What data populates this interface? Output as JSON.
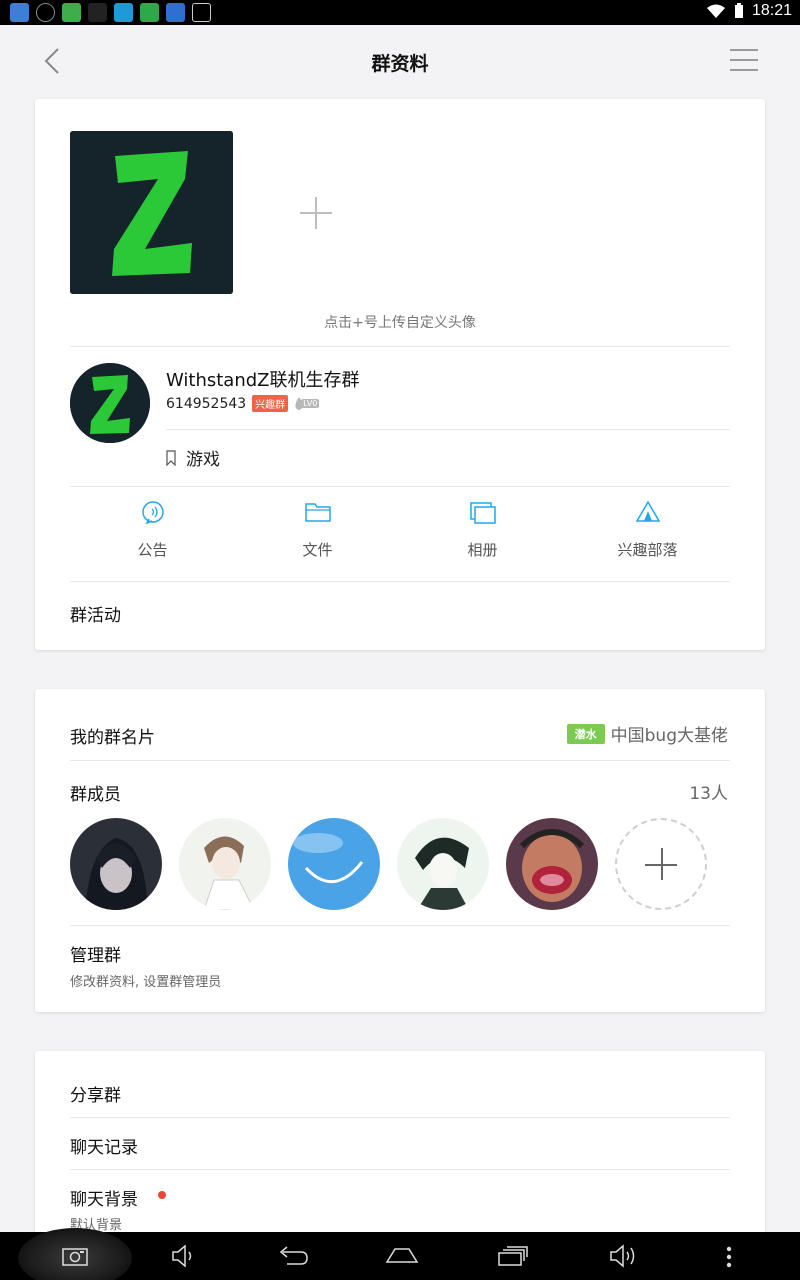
{
  "header": {
    "title": "群资料"
  },
  "status_bar": {
    "time": "18:21"
  },
  "profile": {
    "upload_hint": "点击+号上传自定义头像",
    "group_name": "WithstandZ联机生存群",
    "group_id": "614952543",
    "tag": "兴趣群",
    "level": "LV0",
    "category": "游戏"
  },
  "features": [
    {
      "label": "公告",
      "icon": "announcement-icon"
    },
    {
      "label": "文件",
      "icon": "folder-icon"
    },
    {
      "label": "相册",
      "icon": "album-icon"
    },
    {
      "label": "兴趣部落",
      "icon": "tribe-tent-icon"
    }
  ],
  "group_activity": "群活动",
  "my_card": {
    "label": "我的群名片",
    "badge": "潜水",
    "nickname": "中国bug大基佬"
  },
  "members": {
    "label": "群成员",
    "count": "13人"
  },
  "manage": {
    "label": "管理群",
    "desc": "修改群资料, 设置群管理员"
  },
  "share": "分享群",
  "chat_history": "聊天记录",
  "chat_bg": {
    "label": "聊天背景",
    "desc": "默认背景"
  },
  "colors": {
    "accent": "#22a7e8",
    "green_badge": "#7cc954",
    "red_tag": "#f0624a",
    "dot": "#f0442e"
  }
}
